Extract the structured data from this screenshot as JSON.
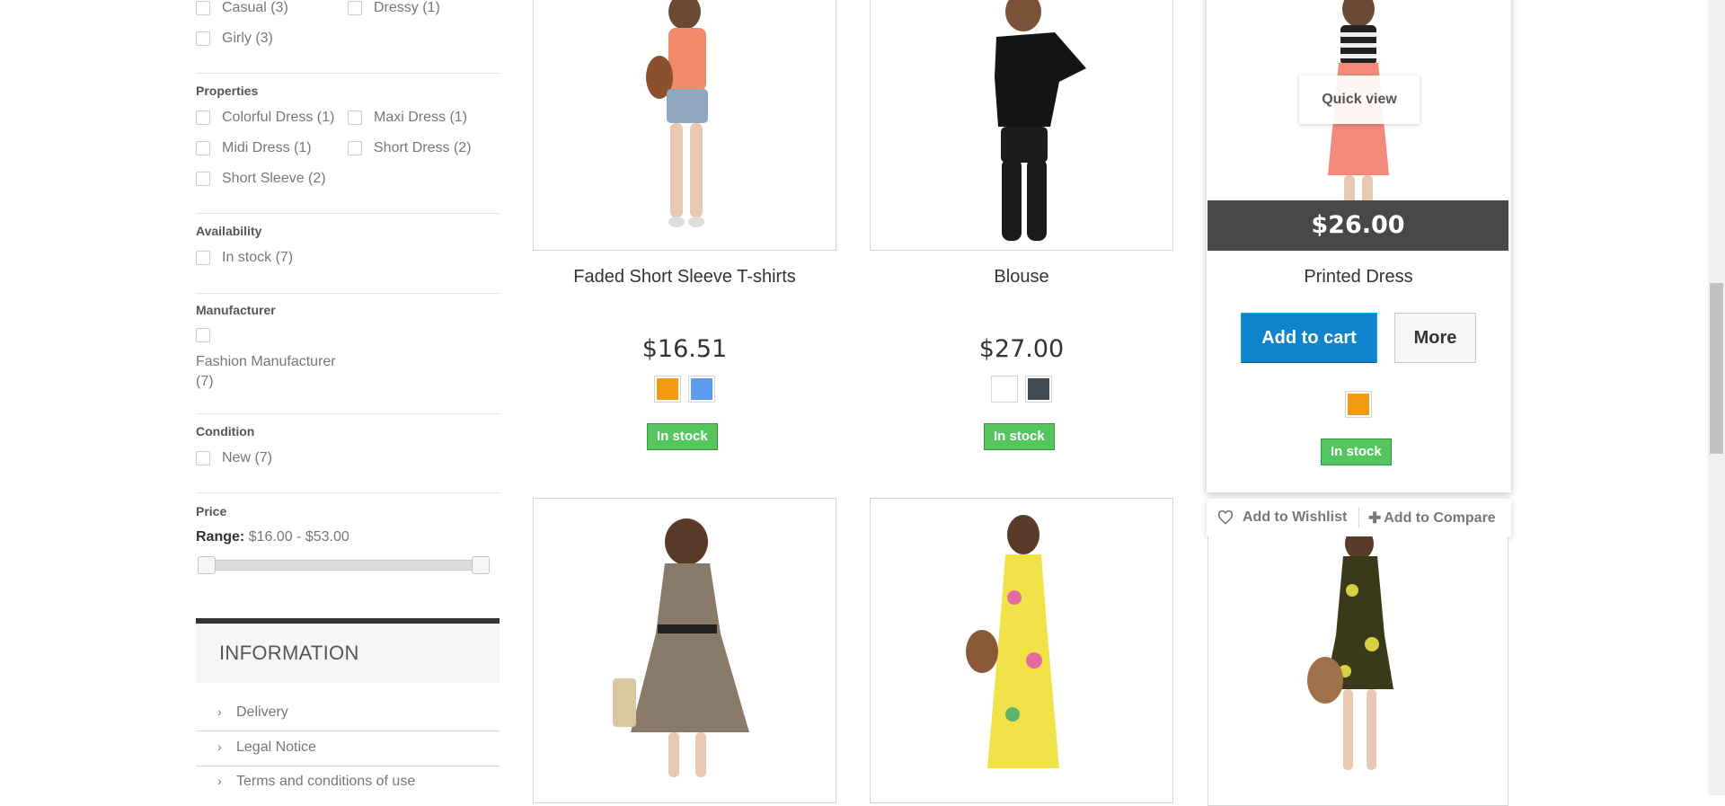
{
  "filters": {
    "styles": [
      {
        "label": "Casual (3)"
      },
      {
        "label": "Dressy (1)"
      },
      {
        "label": "Girly (3)"
      }
    ],
    "properties": {
      "title": "Properties",
      "items": [
        {
          "label": "Colorful Dress (1)"
        },
        {
          "label": "Maxi Dress (1)"
        },
        {
          "label": "Midi Dress (1)"
        },
        {
          "label": "Short Dress (2)"
        },
        {
          "label": "Short Sleeve (2)"
        }
      ]
    },
    "availability": {
      "title": "Availability",
      "items": [
        {
          "label": "In stock (7)"
        }
      ]
    },
    "manufacturer": {
      "title": "Manufacturer",
      "items": [
        {
          "label_line1": "Fashion Manufacturer",
          "label_line2": "(7)"
        }
      ]
    },
    "condition": {
      "title": "Condition",
      "items": [
        {
          "label": "New (7)"
        }
      ]
    },
    "price": {
      "title": "Price",
      "range_label": "Range:",
      "range_value": "$16.00 - $53.00"
    }
  },
  "information": {
    "title": "INFORMATION",
    "items": [
      {
        "label": "Delivery"
      },
      {
        "label": "Legal Notice"
      },
      {
        "label": "Terms and conditions of use"
      }
    ]
  },
  "products": [
    {
      "name": "Faded Short Sleeve T-shirts",
      "price": "$16.51",
      "colors": [
        "#f39c11",
        "#5d9cec"
      ],
      "stock": "In stock"
    },
    {
      "name": "Blouse",
      "price": "$27.00",
      "colors": [
        "#ffffff",
        "#434a54"
      ],
      "stock": "In stock"
    },
    {
      "name": "Printed Dress",
      "price": "$26.00",
      "colors": [
        "#f39c11"
      ],
      "stock": "In stock",
      "quick_view": "Quick view",
      "add_to_cart": "Add to cart",
      "more": "More",
      "wishlist": "Add to Wishlist",
      "compare": "Add to Compare"
    }
  ]
}
